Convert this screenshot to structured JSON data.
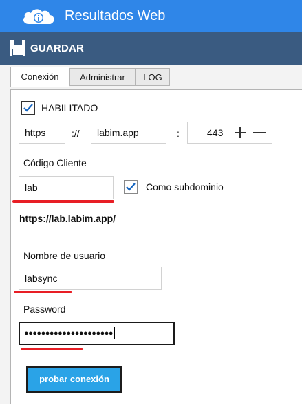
{
  "app": {
    "title": "Resultados Web"
  },
  "toolbar": {
    "save_label": "GUARDAR"
  },
  "tabs": [
    {
      "label": "Conexión",
      "active": true
    },
    {
      "label": "Administrar",
      "active": false
    },
    {
      "label": "LOG",
      "active": false
    }
  ],
  "connection": {
    "enabled_label": "HABILITADO",
    "enabled_checked": true,
    "protocol": "https",
    "separator": "://",
    "host": "labim.app",
    "colon": ":",
    "port": "443",
    "client_code_label": "Código Cliente",
    "client_code": "lab",
    "subdomain_label": "Como subdominio",
    "subdomain_checked": true,
    "resulting_url": "https://lab.labim.app/",
    "username_label": "Nombre de usuario",
    "username": "labsync",
    "password_label": "Password",
    "password_mask": "●●●●●●●●●●●●●●●●●●●●●",
    "test_button_label": "probar conexión"
  },
  "colors": {
    "titlebar": "#2f86e8",
    "toolbar": "#3a5b81",
    "annotation_red": "#e81e25",
    "test_button": "#2aa3e7"
  }
}
